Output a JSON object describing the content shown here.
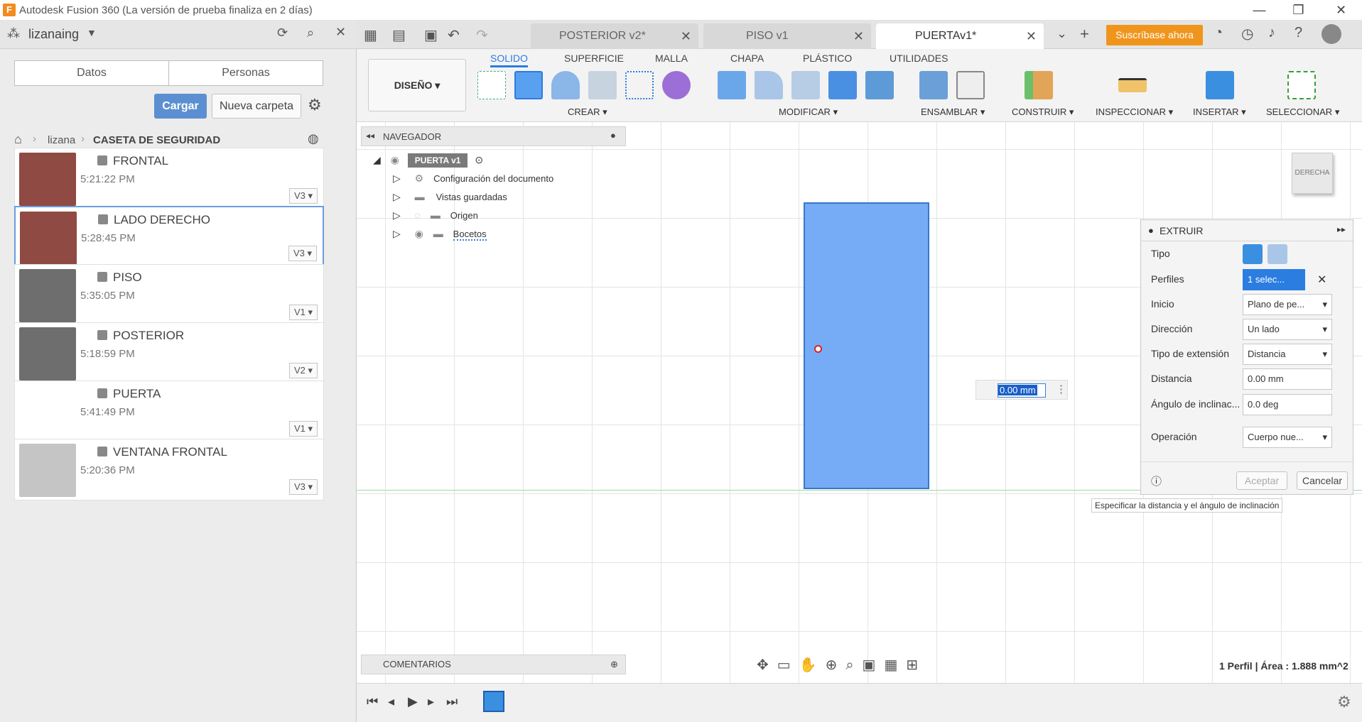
{
  "window": {
    "title": "Autodesk Fusion 360 (La versión de prueba finaliza en 2 días)",
    "logo_letter": "F",
    "controls": [
      "—",
      "❐",
      "✕"
    ]
  },
  "left_panel": {
    "user": "lizanaing",
    "segments": [
      "Datos",
      "Personas"
    ],
    "upload_label": "Cargar",
    "new_folder_label": "Nueva carpeta",
    "breadcrumb": [
      "lizana",
      "CASETA DE SEGURIDAD"
    ],
    "files": [
      {
        "name": "FRONTAL",
        "time": "5:21:22 PM",
        "version": "V3"
      },
      {
        "name": "LADO DERECHO",
        "time": "5:28:45 PM",
        "version": "V3"
      },
      {
        "name": "PISO",
        "time": "5:35:05 PM",
        "version": "V1"
      },
      {
        "name": "POSTERIOR",
        "time": "5:18:59 PM",
        "version": "V2"
      },
      {
        "name": "PUERTA",
        "time": "5:41:49 PM",
        "version": "V1"
      },
      {
        "name": "VENTANA FRONTAL",
        "time": "5:20:36 PM",
        "version": "V3"
      }
    ]
  },
  "tabs": [
    {
      "label": "POSTERIOR v2*",
      "active": false
    },
    {
      "label": "PISO v1",
      "active": false
    },
    {
      "label": "PUERTAv1*",
      "active": true
    }
  ],
  "subscribe_label": "Suscríbase ahora",
  "ribbon": {
    "workspace": "DISEÑO",
    "tabs": [
      "SOLIDO",
      "SUPERFICIE",
      "MALLA",
      "CHAPA",
      "PLÁSTICO",
      "UTILIDADES"
    ],
    "groups": [
      "CREAR",
      "MODIFICAR",
      "ENSAMBLAR",
      "CONSTRUIR",
      "INSPECCIONAR",
      "INSERTAR",
      "SELECCIONAR"
    ]
  },
  "navigator": {
    "header": "NAVEGADOR",
    "root": "PUERTA v1",
    "items": [
      "Configuración del documento",
      "Vistas guardadas",
      "Origen",
      "Bocetos"
    ]
  },
  "viewcube_label": "DERECHA",
  "distance_input": "0.00 mm",
  "extrude": {
    "title": "EXTRUIR",
    "rows": [
      {
        "label": "Tipo",
        "value": ""
      },
      {
        "label": "Perfiles",
        "value": "1 selec..."
      },
      {
        "label": "Inicio",
        "value": "Plano de pe..."
      },
      {
        "label": "Dirección",
        "value": "Un lado"
      },
      {
        "label": "Tipo de extensión",
        "value": "Distancia"
      },
      {
        "label": "Distancia",
        "value": "0.00 mm"
      },
      {
        "label": "Ángulo de inclinac...",
        "value": "0.0 deg"
      },
      {
        "label": "Operación",
        "value": "Cuerpo nue..."
      }
    ],
    "ok_label": "Aceptar",
    "cancel_label": "Cancelar",
    "tooltip": "Especificar la distancia y el ángulo de inclinación"
  },
  "comments_label": "COMENTARIOS",
  "status_text": "1 Perfil | Área : 1.888 mm^2",
  "colors": {
    "accent": "#2b7de0",
    "profile": "#6fa8f5",
    "subscribe": "#f0951c"
  }
}
